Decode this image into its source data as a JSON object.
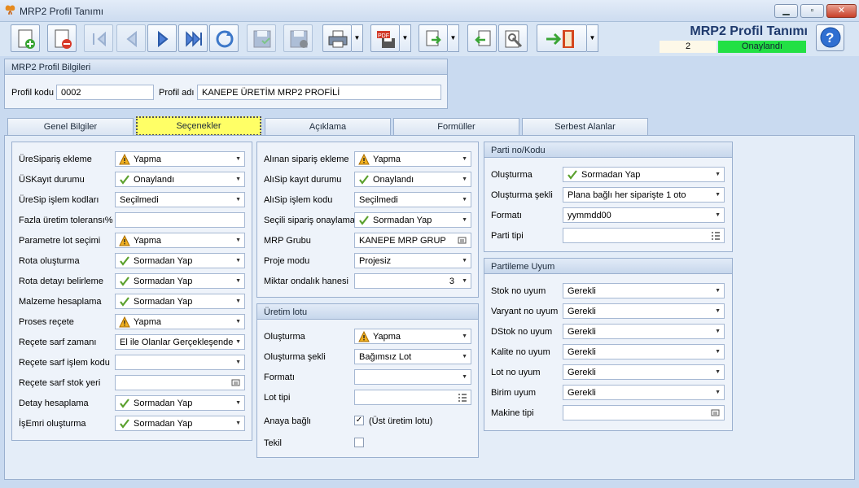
{
  "window": {
    "title": "MRP2 Profil Tanımı"
  },
  "header": {
    "app_name": "MRP2 Profil Tanımı",
    "doc_no": "2",
    "status": "Onaylandı",
    "status_color": "#22e044"
  },
  "toolbar": {
    "buttons": [
      "new-doc",
      "delete-doc",
      "first-record",
      "previous-record",
      "next-record",
      "last-record",
      "refresh",
      "save",
      "cancel-save",
      "print",
      "pdf-export",
      "export",
      "import",
      "settings",
      "exit"
    ]
  },
  "profile_info": {
    "title": "MRP2 Profil Bilgileri",
    "code_label": "Profil kodu",
    "code": "0002",
    "name_label": "Profil adı",
    "name": "KANEPE ÜRETİM MRP2 PROFİLİ"
  },
  "tabs": [
    "Genel Bilgiler",
    "Seçenekler",
    "Açıklama",
    "Formüller",
    "Serbest Alanlar"
  ],
  "active_tab": "Seçenekler",
  "left_fields": [
    {
      "label": "ÜreSipariş ekleme",
      "value": "Yapma",
      "icon": "warning"
    },
    {
      "label": "ÜSKayıt durumu",
      "value": "Onaylandı",
      "icon": "check"
    },
    {
      "label": "ÜreSip işlem kodları",
      "value": "Seçilmedi",
      "icon": ""
    },
    {
      "label": "Fazla üretim toleransı%",
      "value": "",
      "icon": "",
      "type": "text"
    },
    {
      "label": "Parametre lot seçimi",
      "value": "Yapma",
      "icon": "warning"
    },
    {
      "label": "Rota oluşturma",
      "value": "Sormadan Yap",
      "icon": "check"
    },
    {
      "label": "Rota detayı belirleme",
      "value": "Sormadan Yap",
      "icon": "check"
    },
    {
      "label": "Malzeme hesaplama",
      "value": "Sormadan Yap",
      "icon": "check"
    },
    {
      "label": "Proses reçete",
      "value": "Yapma",
      "icon": "warning"
    },
    {
      "label": "Reçete sarf zamanı",
      "value": "El ile Olanlar Gerçekleşende",
      "icon": ""
    },
    {
      "label": "Reçete sarf işlem kodu",
      "value": "",
      "icon": ""
    },
    {
      "label": "Reçete sarf stok yeri",
      "value": "",
      "icon": "",
      "type": "lookup"
    },
    {
      "label": "Detay hesaplama",
      "value": "Sormadan Yap",
      "icon": "check"
    },
    {
      "label": "İşEmri oluşturma",
      "value": "Sormadan Yap",
      "icon": "check"
    }
  ],
  "middle_fields": [
    {
      "label": "Alınan sipariş ekleme",
      "value": "Yapma",
      "icon": "warning"
    },
    {
      "label": "AlıSip kayıt durumu",
      "value": "Onaylandı",
      "icon": "check"
    },
    {
      "label": "AlıSip işlem kodu",
      "value": "Seçilmedi",
      "icon": ""
    },
    {
      "label": "Seçili sipariş onaylama",
      "value": "Sormadan Yap",
      "icon": "check"
    },
    {
      "label": "MRP Grubu",
      "value": "KANEPE MRP GRUP",
      "icon": "",
      "type": "lookup"
    },
    {
      "label": "Proje modu",
      "value": "Projesiz",
      "icon": ""
    },
    {
      "label": "Miktar ondalık hanesi",
      "value": "3",
      "icon": "",
      "type": "spin"
    }
  ],
  "production_lot": {
    "title": "Üretim lotu",
    "fields": [
      {
        "label": "Oluşturma",
        "value": "Yapma",
        "icon": "warning"
      },
      {
        "label": "Oluşturma şekli",
        "value": "Bağımsız Lot",
        "icon": ""
      },
      {
        "label": "Formatı",
        "value": "",
        "icon": ""
      },
      {
        "label": "Lot tipi",
        "value": "",
        "icon": "",
        "type": "list"
      }
    ],
    "parent_label": "Anaya bağlı",
    "parent_checked": true,
    "parent_note": "(Üst üretim lotu)",
    "single_label": "Tekil",
    "single_checked": false
  },
  "batch": {
    "title": "Parti no/Kodu",
    "fields": [
      {
        "label": "Oluşturma",
        "value": "Sormadan Yap",
        "icon": "check"
      },
      {
        "label": "Oluşturma şekli",
        "value": "Plana bağlı her siparişte 1 oto",
        "icon": ""
      },
      {
        "label": "Formatı",
        "value": "yymmdd00",
        "icon": ""
      },
      {
        "label": "Parti tipi",
        "value": "",
        "icon": "",
        "type": "list"
      }
    ]
  },
  "match": {
    "title": "Partileme Uyum",
    "fields": [
      {
        "label": "Stok no uyum",
        "value": "Gerekli"
      },
      {
        "label": "Varyant no uyum",
        "value": "Gerekli"
      },
      {
        "label": "DStok no uyum",
        "value": "Gerekli"
      },
      {
        "label": "Kalite no uyum",
        "value": "Gerekli"
      },
      {
        "label": "Lot no uyum",
        "value": "Gerekli"
      },
      {
        "label": "Birim uyum",
        "value": "Gerekli"
      },
      {
        "label": "Makine tipi",
        "value": "",
        "type": "lookup"
      }
    ]
  }
}
